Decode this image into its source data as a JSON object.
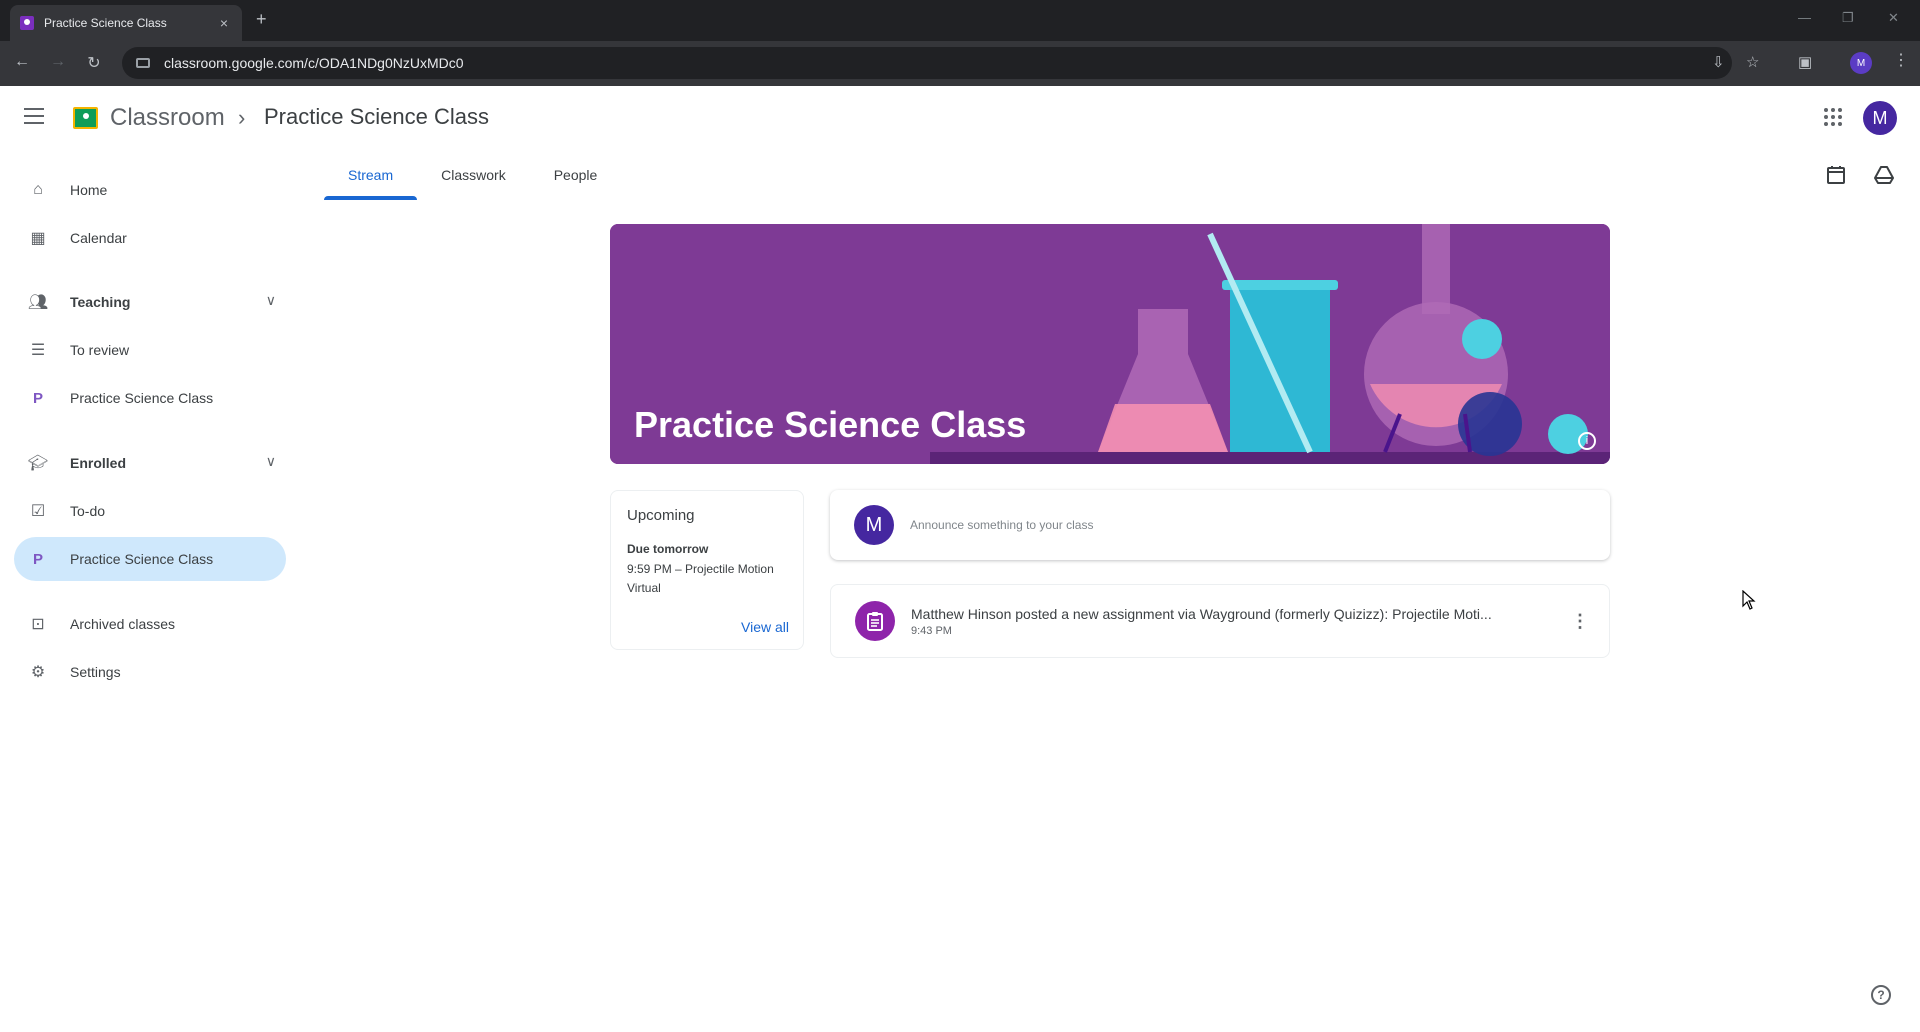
{
  "browser": {
    "tab_title": "Practice Science Class",
    "tab_close": "×",
    "new_tab": "+",
    "url": "classroom.google.com/c/ODA1NDg0NzUxMDc0",
    "profile_initial": "M"
  },
  "header": {
    "brand": "Classroom",
    "separator": "›",
    "class_title": "Practice Science Class",
    "avatar_initial": "M"
  },
  "sidebar": {
    "items": [
      {
        "label": "Home"
      },
      {
        "label": "Calendar"
      },
      {
        "label": "Teaching"
      },
      {
        "label": "To review"
      },
      {
        "label": "Practice Science Class",
        "letter": "P"
      },
      {
        "label": "Enrolled"
      },
      {
        "label": "To-do"
      },
      {
        "label": "Practice Science Class",
        "letter": "P"
      },
      {
        "label": "Archived classes"
      },
      {
        "label": "Settings"
      }
    ]
  },
  "tabs": [
    {
      "label": "Stream"
    },
    {
      "label": "Classwork"
    },
    {
      "label": "People"
    }
  ],
  "banner": {
    "title": "Practice Science Class"
  },
  "upcoming": {
    "title": "Upcoming",
    "due": "Due tomorrow",
    "item": "9:59 PM – Projectile Motion",
    "item2": "Virtual",
    "view_all": "View all"
  },
  "announce": {
    "avatar_initial": "M",
    "placeholder": "Announce something to your class"
  },
  "posts": [
    {
      "title": "Matthew Hinson posted a new assignment via Wayground (formerly Quizizz): Projectile Moti...",
      "time": "9:43 PM"
    }
  ],
  "colors": {
    "accent": "#1967d2",
    "banner": "#8b2f9c",
    "active_nav": "#cfe8fc",
    "avatar": "#4527a0"
  },
  "icons": {
    "help": "?",
    "info": "i"
  }
}
